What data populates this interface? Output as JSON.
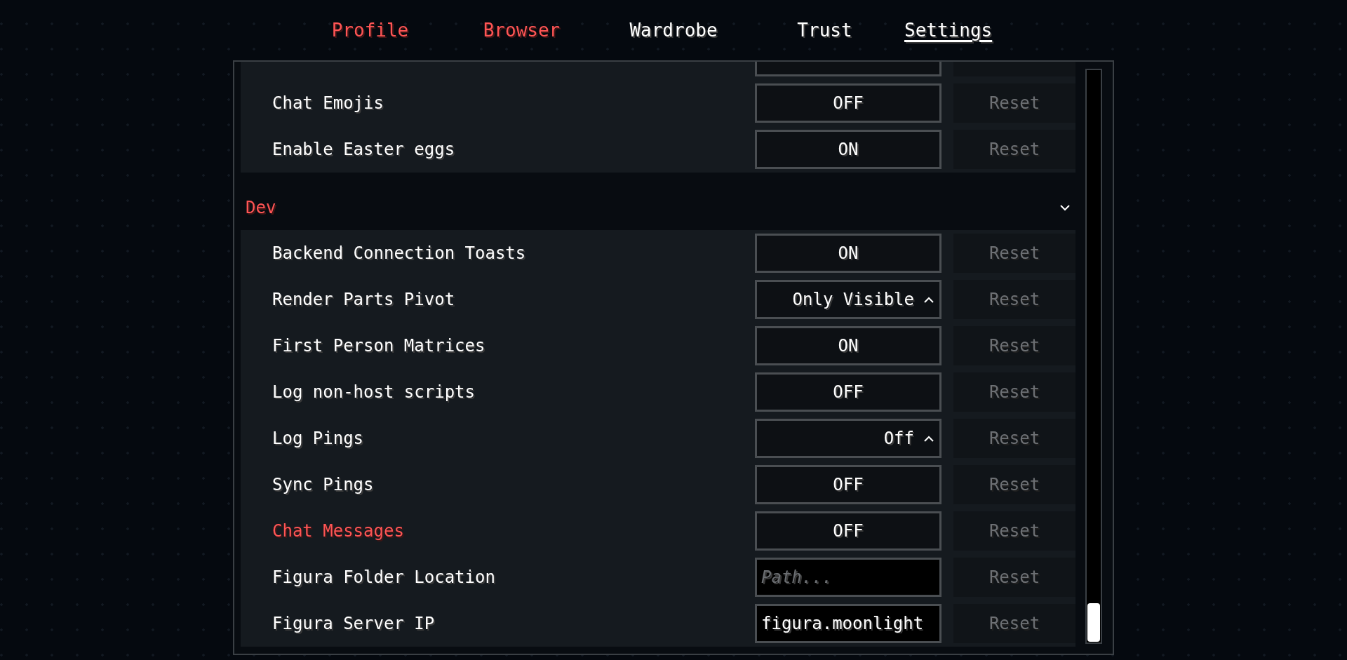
{
  "tabs": [
    {
      "label": "Profile",
      "selected": false,
      "highlighted": true
    },
    {
      "label": "Browser",
      "selected": false,
      "highlighted": true
    },
    {
      "label": "Wardrobe",
      "selected": false,
      "highlighted": false
    },
    {
      "label": "Trust",
      "selected": false,
      "highlighted": false
    },
    {
      "label": "Settings",
      "selected": true,
      "highlighted": false
    }
  ],
  "sections": [
    {
      "rows": [
        {
          "kind": "toggle",
          "reset": {
            "disabled": true
          }
        },
        {
          "kind": "toggle",
          "label": "Chat Emojis",
          "value": "OFF",
          "highlighted": false,
          "reset": {
            "label": "Reset",
            "disabled": true
          }
        },
        {
          "kind": "toggle",
          "label": "Enable Easter eggs",
          "value": "ON",
          "highlighted": false,
          "reset": {
            "label": "Reset",
            "disabled": true
          }
        }
      ]
    },
    {
      "title": "Dev",
      "expanded": true,
      "rows": [
        {
          "kind": "toggle",
          "label": "Backend Connection Toasts",
          "value": "ON",
          "highlighted": false,
          "reset": {
            "label": "Reset",
            "disabled": true
          }
        },
        {
          "kind": "dropdown",
          "label": "Render Parts Pivot",
          "value": "Only Visible",
          "highlighted": false,
          "reset": {
            "label": "Reset",
            "disabled": true
          }
        },
        {
          "kind": "toggle",
          "label": "First Person Matrices",
          "value": "ON",
          "highlighted": false,
          "reset": {
            "label": "Reset",
            "disabled": true
          }
        },
        {
          "kind": "toggle",
          "label": "Log non-host scripts",
          "value": "OFF",
          "highlighted": false,
          "reset": {
            "label": "Reset",
            "disabled": true
          }
        },
        {
          "kind": "dropdown",
          "label": "Log Pings",
          "value": "Off",
          "highlighted": false,
          "reset": {
            "label": "Reset",
            "disabled": true
          }
        },
        {
          "kind": "toggle",
          "label": "Sync Pings",
          "value": "OFF",
          "highlighted": false,
          "reset": {
            "label": "Reset",
            "disabled": true
          }
        },
        {
          "kind": "toggle",
          "label": "Chat Messages",
          "value": "OFF",
          "highlighted": true,
          "reset": {
            "label": "Reset",
            "disabled": true
          }
        },
        {
          "kind": "text",
          "label": "Figura Folder Location",
          "placeholder": "Path...",
          "highlighted": false,
          "reset": {
            "label": "Reset",
            "disabled": true
          }
        },
        {
          "kind": "text",
          "label": "Figura Server IP",
          "value": "figura.moonlight",
          "highlighted": false,
          "reset": {
            "label": "Reset",
            "disabled": true
          }
        }
      ]
    }
  ]
}
